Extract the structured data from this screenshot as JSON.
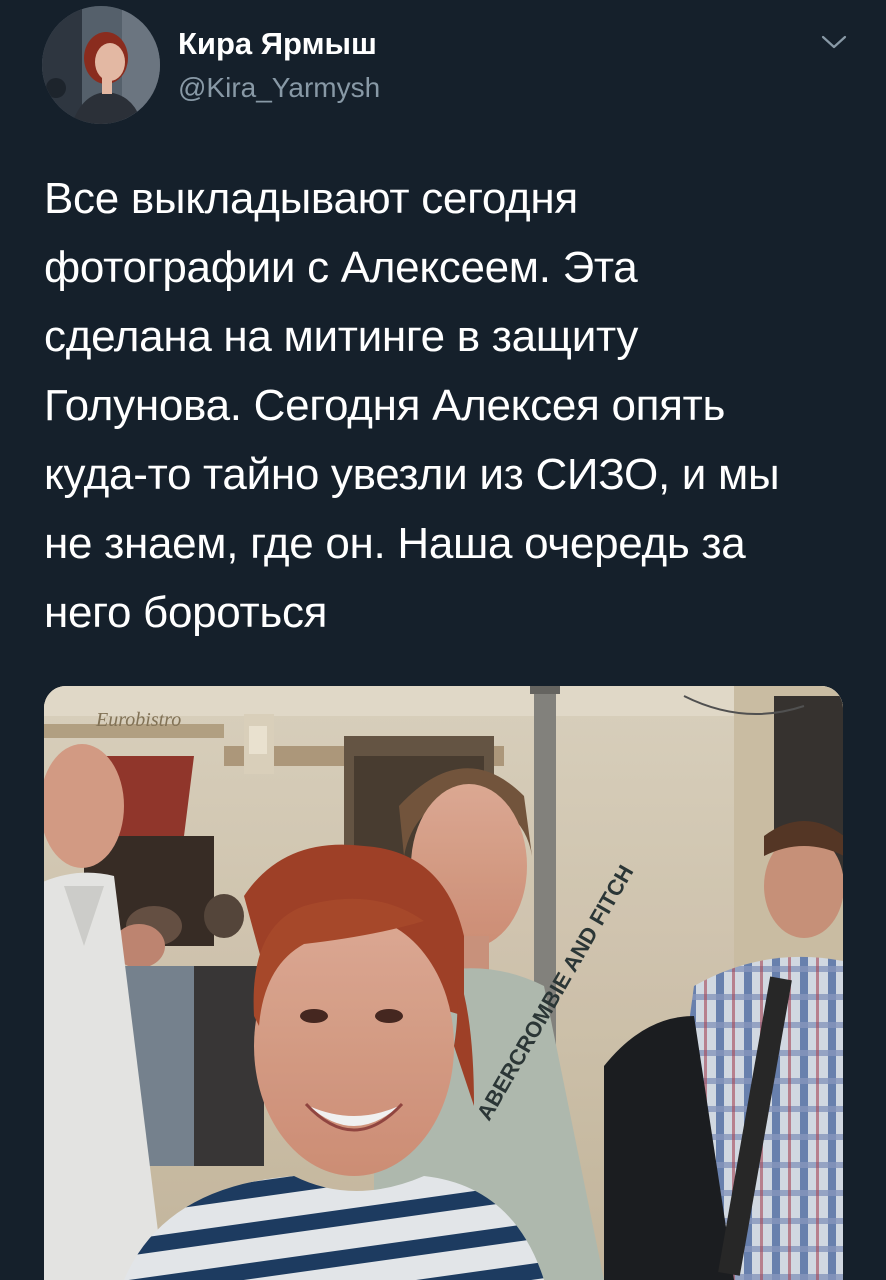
{
  "author": {
    "display_name": "Кира Ярмыш",
    "handle": "@Kira_Yarmysh",
    "avatar_icon": "profile-photo"
  },
  "menu": {
    "icon": "chevron-down-icon"
  },
  "tweet": {
    "lines": [
      "Все выкладывают сегодня",
      "фотографии с Алексеем. Эта",
      "сделана на митинге в защиту",
      "Голунова. Сегодня Алексея опять",
      "куда-то тайно увезли из СИЗО, и мы",
      "не знаем, где он. Наша очередь за",
      "него бороться"
    ]
  },
  "media": {
    "sign_text": "Eurobistro",
    "shirt_text": "ABERCROMBIE AND FITCH"
  },
  "colors": {
    "background": "#15202b",
    "text": "#ffffff",
    "secondary": "#8899a6"
  }
}
